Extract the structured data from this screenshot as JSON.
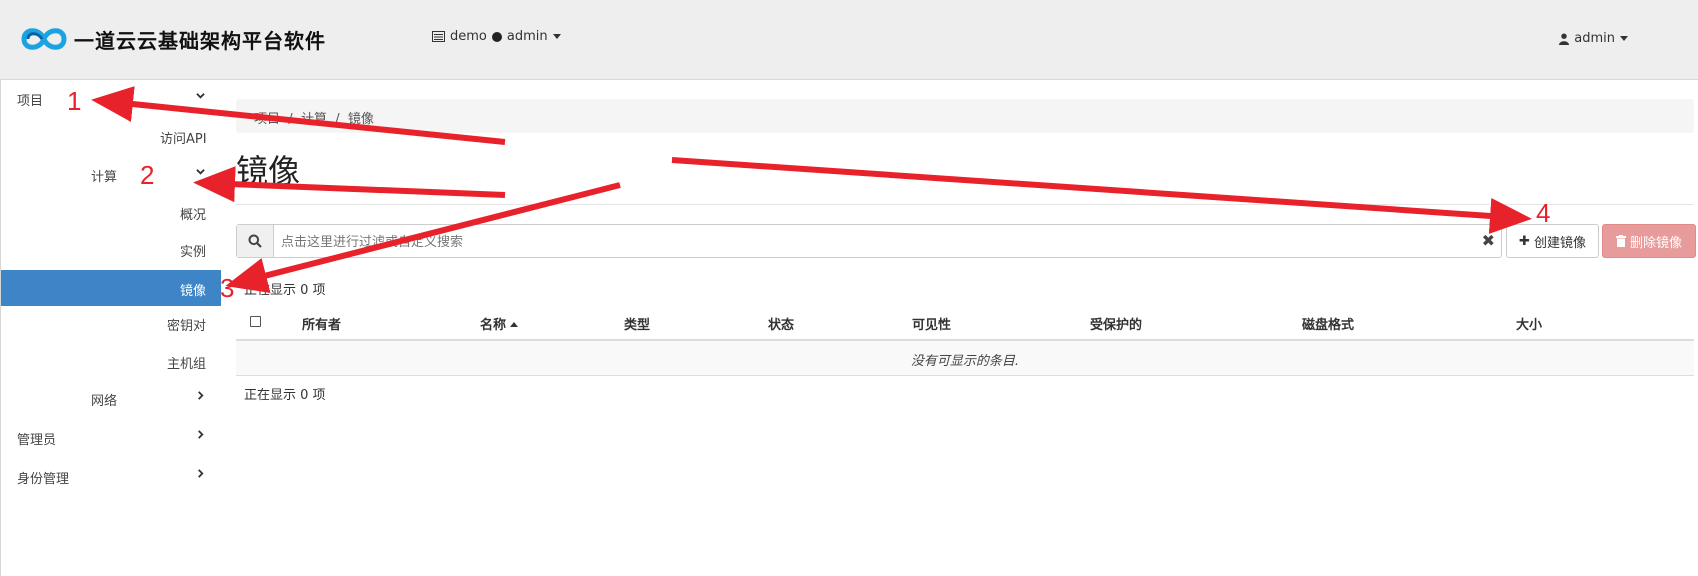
{
  "header": {
    "brand_name": "一道云云基础架构平台软件",
    "project": "demo",
    "project_user": "admin",
    "user": "admin"
  },
  "sidebar": {
    "project": "项目",
    "access_api": "访问API",
    "compute": "计算",
    "overview": "概况",
    "instances": "实例",
    "images": "镜像",
    "key_pairs": "密钥对",
    "host_groups": "主机组",
    "network": "网络",
    "admin": "管理员",
    "identity": "身份管理"
  },
  "breadcrumb": [
    "项目",
    "计算",
    "镜像"
  ],
  "page_title": "镜像",
  "search": {
    "placeholder": "点击这里进行过滤或自定义搜索",
    "clear": "✖"
  },
  "actions": {
    "create": "创建镜像",
    "delete": "删除镜像"
  },
  "table": {
    "count_text": "正在显示 0 项",
    "columns": [
      "所有者",
      "名称",
      "类型",
      "状态",
      "可见性",
      "受保护的",
      "磁盘格式",
      "大小"
    ],
    "sorted_column": "名称",
    "empty_text": "没有可显示的条目."
  },
  "annotations": {
    "labels": [
      "1",
      "2",
      "3",
      "4"
    ],
    "color": "#e8222b"
  },
  "colors": {
    "active_nav": "#3d85c6",
    "danger_button": "#e89b9b",
    "topbar": "#eeeeee"
  }
}
